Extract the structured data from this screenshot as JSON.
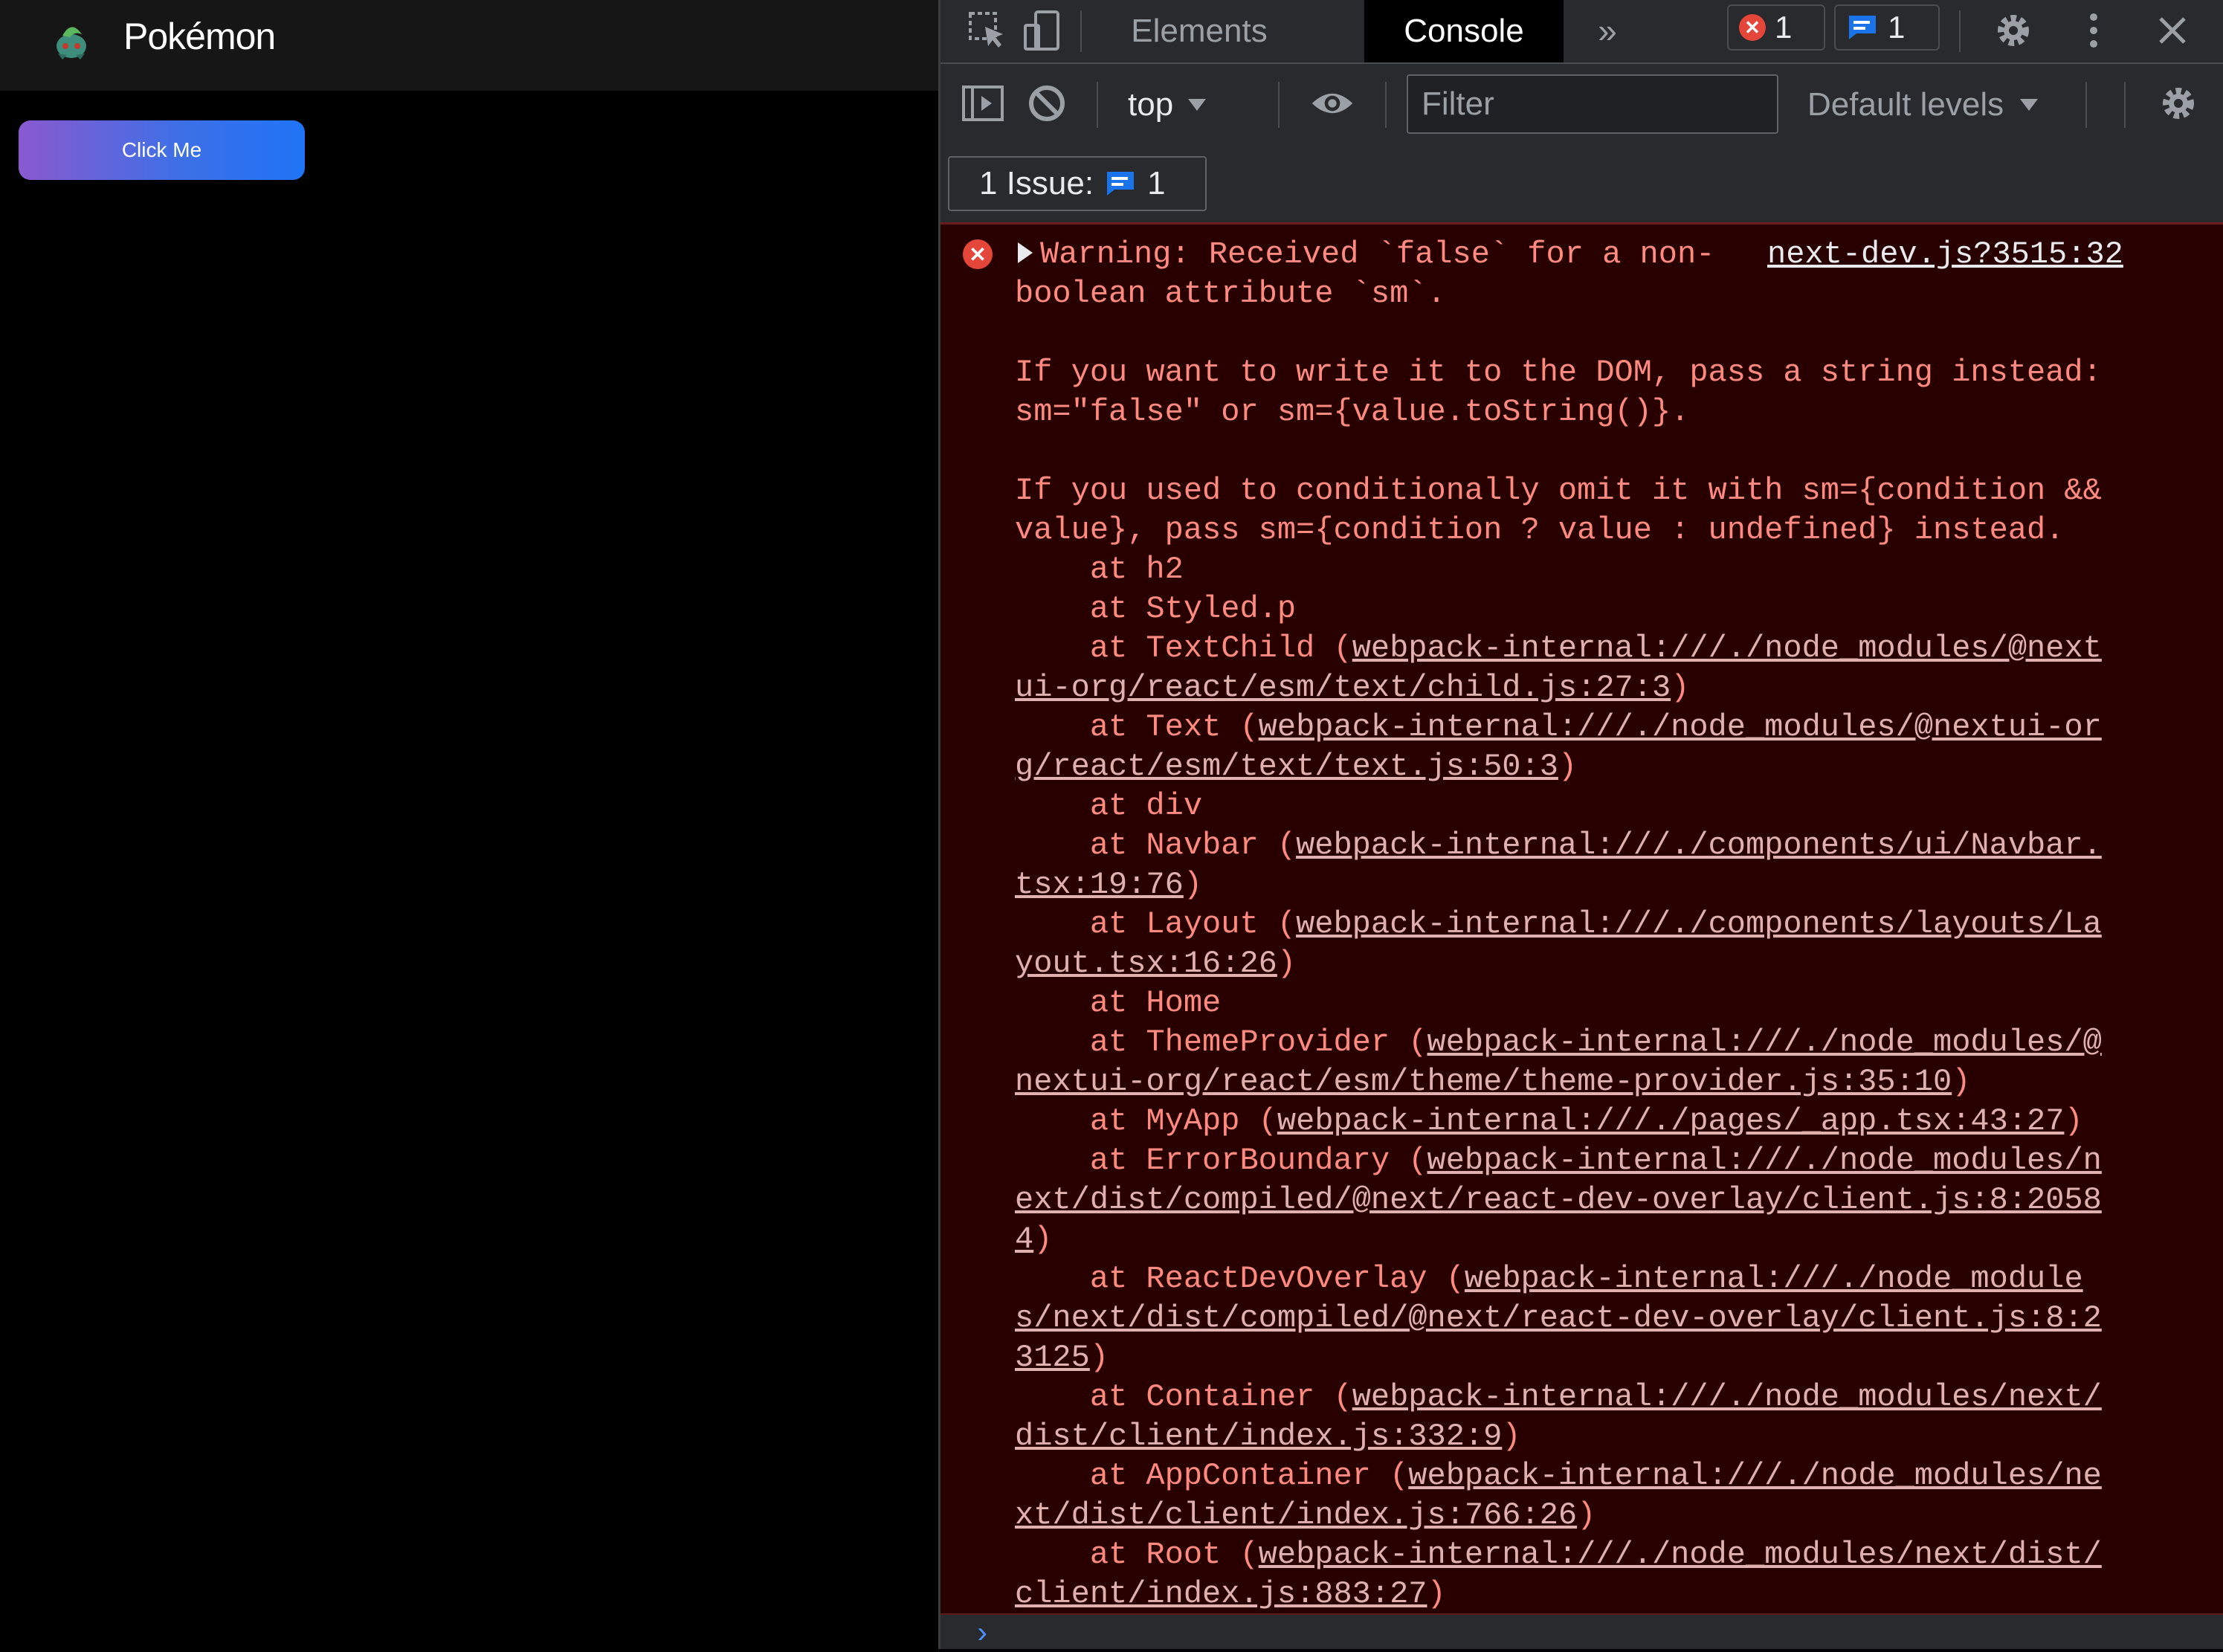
{
  "page": {
    "brand": "Pokémon",
    "button_label": "Click Me"
  },
  "devtools": {
    "tabs": [
      "Elements",
      "Console"
    ],
    "active_tab": "Console",
    "error_count": "1",
    "message_count": "1",
    "context": "top",
    "filter_placeholder": "Filter",
    "levels": "Default levels",
    "issues_label": "1 Issue:",
    "issues_count": "1"
  },
  "console": {
    "source": "next-dev.js?3515:32",
    "lines": [
      [
        {
          "t": "Warning: Received `false` for a non-"
        }
      ],
      [
        {
          "t": "boolean attribute `sm`."
        }
      ],
      [
        {
          "t": ""
        }
      ],
      [
        {
          "t": "If you want to write it to the DOM, pass a string instead:"
        }
      ],
      [
        {
          "t": "sm=\"false\" or sm={value.toString()}."
        }
      ],
      [
        {
          "t": ""
        }
      ],
      [
        {
          "t": "If you used to conditionally omit it with sm={condition &&"
        }
      ],
      [
        {
          "t": "value}, pass sm={condition ? value : undefined} instead."
        }
      ],
      [
        {
          "t": "    at h2"
        }
      ],
      [
        {
          "t": "    at Styled.p"
        }
      ],
      [
        {
          "t": "    at TextChild ("
        },
        {
          "t": "webpack-internal:///./node_modules/@next",
          "u": true
        }
      ],
      [
        {
          "t": "ui-org/react/esm/text/child.js:27:3",
          "u": true
        },
        {
          "t": ")"
        }
      ],
      [
        {
          "t": "    at Text ("
        },
        {
          "t": "webpack-internal:///./node_modules/@nextui-or",
          "u": true
        }
      ],
      [
        {
          "t": "g/react/esm/text/text.js:50:3",
          "u": true
        },
        {
          "t": ")"
        }
      ],
      [
        {
          "t": "    at div"
        }
      ],
      [
        {
          "t": "    at Navbar ("
        },
        {
          "t": "webpack-internal:///./components/ui/Navbar.",
          "u": true
        }
      ],
      [
        {
          "t": "tsx:19:76",
          "u": true
        },
        {
          "t": ")"
        }
      ],
      [
        {
          "t": "    at Layout ("
        },
        {
          "t": "webpack-internal:///./components/layouts/La",
          "u": true
        }
      ],
      [
        {
          "t": "yout.tsx:16:26",
          "u": true
        },
        {
          "t": ")"
        }
      ],
      [
        {
          "t": "    at Home"
        }
      ],
      [
        {
          "t": "    at ThemeProvider ("
        },
        {
          "t": "webpack-internal:///./node_modules/@",
          "u": true
        }
      ],
      [
        {
          "t": "nextui-org/react/esm/theme/theme-provider.js:35:10",
          "u": true
        },
        {
          "t": ")"
        }
      ],
      [
        {
          "t": "    at MyApp ("
        },
        {
          "t": "webpack-internal:///./pages/_app.tsx:43:27",
          "u": true
        },
        {
          "t": ")"
        }
      ],
      [
        {
          "t": "    at ErrorBoundary ("
        },
        {
          "t": "webpack-internal:///./node_modules/n",
          "u": true
        }
      ],
      [
        {
          "t": "ext/dist/compiled/@next/react-dev-overlay/client.js:8:2058",
          "u": true
        }
      ],
      [
        {
          "t": "4",
          "u": true
        },
        {
          "t": ")"
        }
      ],
      [
        {
          "t": "    at ReactDevOverlay ("
        },
        {
          "t": "webpack-internal:///./node_module",
          "u": true
        }
      ],
      [
        {
          "t": "s/next/dist/compiled/@next/react-dev-overlay/client.js:8:2",
          "u": true
        }
      ],
      [
        {
          "t": "3125",
          "u": true
        },
        {
          "t": ")"
        }
      ],
      [
        {
          "t": "    at Container ("
        },
        {
          "t": "webpack-internal:///./node_modules/next/",
          "u": true
        }
      ],
      [
        {
          "t": "dist/client/index.js:332:9",
          "u": true
        },
        {
          "t": ")"
        }
      ],
      [
        {
          "t": "    at AppContainer ("
        },
        {
          "t": "webpack-internal:///./node_modules/ne",
          "u": true
        }
      ],
      [
        {
          "t": "xt/dist/client/index.js:766:26",
          "u": true
        },
        {
          "t": ")"
        }
      ],
      [
        {
          "t": "    at Root ("
        },
        {
          "t": "webpack-internal:///./node_modules/next/dist/",
          "u": true
        }
      ],
      [
        {
          "t": "client/index.js:883:27",
          "u": true
        },
        {
          "t": ")"
        }
      ]
    ]
  },
  "colors": {
    "error_text": "#ff8a80",
    "error_bg": "#290000",
    "accent_blue": "#1a73e8"
  },
  "icons": [
    "inspect-icon",
    "device-toolbar-icon",
    "more-tabs-icon",
    "error-icon",
    "message-icon",
    "settings-icon",
    "kebab-menu-icon",
    "close-icon",
    "sidebar-toggle-icon",
    "clear-console-icon",
    "dropdown-icon",
    "eye-icon",
    "gear-icon"
  ]
}
